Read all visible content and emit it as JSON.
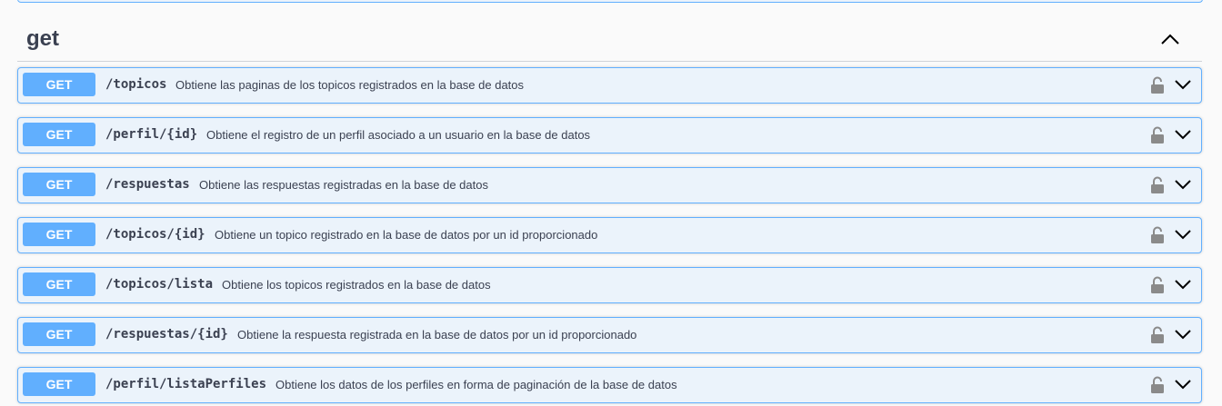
{
  "tag": {
    "title": "get",
    "toggle_icon": "chevron-up-icon"
  },
  "operations": [
    {
      "method": "GET",
      "path": "/topicos",
      "summary": "Obtiene las paginas de los topicos registrados en la base de datos"
    },
    {
      "method": "GET",
      "path": "/perfil/{id}",
      "summary": "Obtiene el registro de un perfil asociado a un usuario en la base de datos"
    },
    {
      "method": "GET",
      "path": "/respuestas",
      "summary": "Obtiene las respuestas registradas en la base de datos"
    },
    {
      "method": "GET",
      "path": "/topicos/{id}",
      "summary": "Obtiene un topico registrado en la base de datos por un id proporcionado"
    },
    {
      "method": "GET",
      "path": "/topicos/lista",
      "summary": "Obtiene los topicos registrados en la base de datos"
    },
    {
      "method": "GET",
      "path": "/respuestas/{id}",
      "summary": "Obtiene la respuesta registrada en la base de datos por un id proporcionado"
    },
    {
      "method": "GET",
      "path": "/perfil/listaPerfiles",
      "summary": "Obtiene los datos de los perfiles en forma de paginación de la base de datos"
    }
  ],
  "colors": {
    "get_accent": "#61affe",
    "get_background": "#ebf3fb",
    "text": "#3b4151"
  }
}
